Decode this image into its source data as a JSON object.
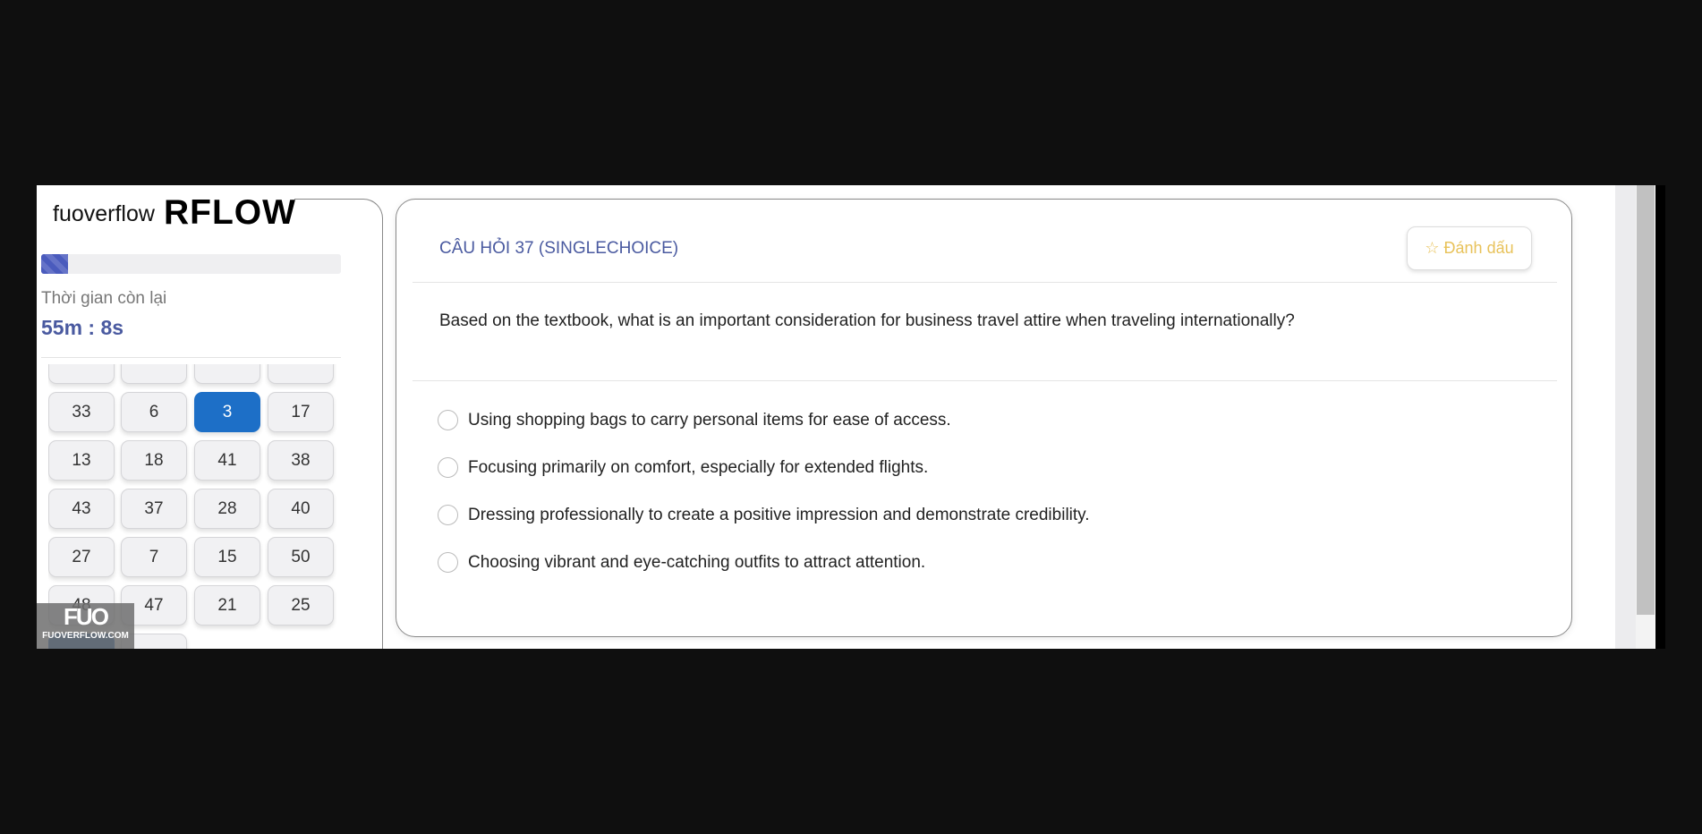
{
  "logo": {
    "small": "fuoverflow",
    "big": "RFLOW"
  },
  "progress": {
    "percent": 9
  },
  "timer": {
    "label": "Thời gian còn lại",
    "value": "55m : 8s"
  },
  "grid": {
    "rows": [
      [
        "",
        "",
        "",
        ""
      ],
      [
        "33",
        "6",
        "3",
        "17"
      ],
      [
        "13",
        "18",
        "41",
        "38"
      ],
      [
        "43",
        "37",
        "28",
        "40"
      ],
      [
        "27",
        "7",
        "15",
        "50"
      ],
      [
        "48",
        "47",
        "21",
        "25"
      ],
      [
        "",
        ""
      ]
    ],
    "active": "3"
  },
  "watermark": {
    "big": "FUO",
    "small": "FUOVERFLOW.COM"
  },
  "question": {
    "title": "CÂU HỎI 37 (SINGLECHOICE)",
    "text": "Based on the textbook, what is an important consideration for business travel attire when traveling internationally?",
    "bookmark_label": "Đánh dấu",
    "options": [
      "Using shopping bags to carry personal items for ease of access.",
      "Focusing primarily on comfort, especially for extended flights.",
      "Dressing professionally to create a positive impression and demonstrate credibility.",
      "Choosing vibrant and eye-catching outfits to attract attention."
    ]
  },
  "colors": {
    "accent": "#4a5aa0",
    "active_button": "#1d6fc7",
    "bookmark": "#e8c25a"
  }
}
